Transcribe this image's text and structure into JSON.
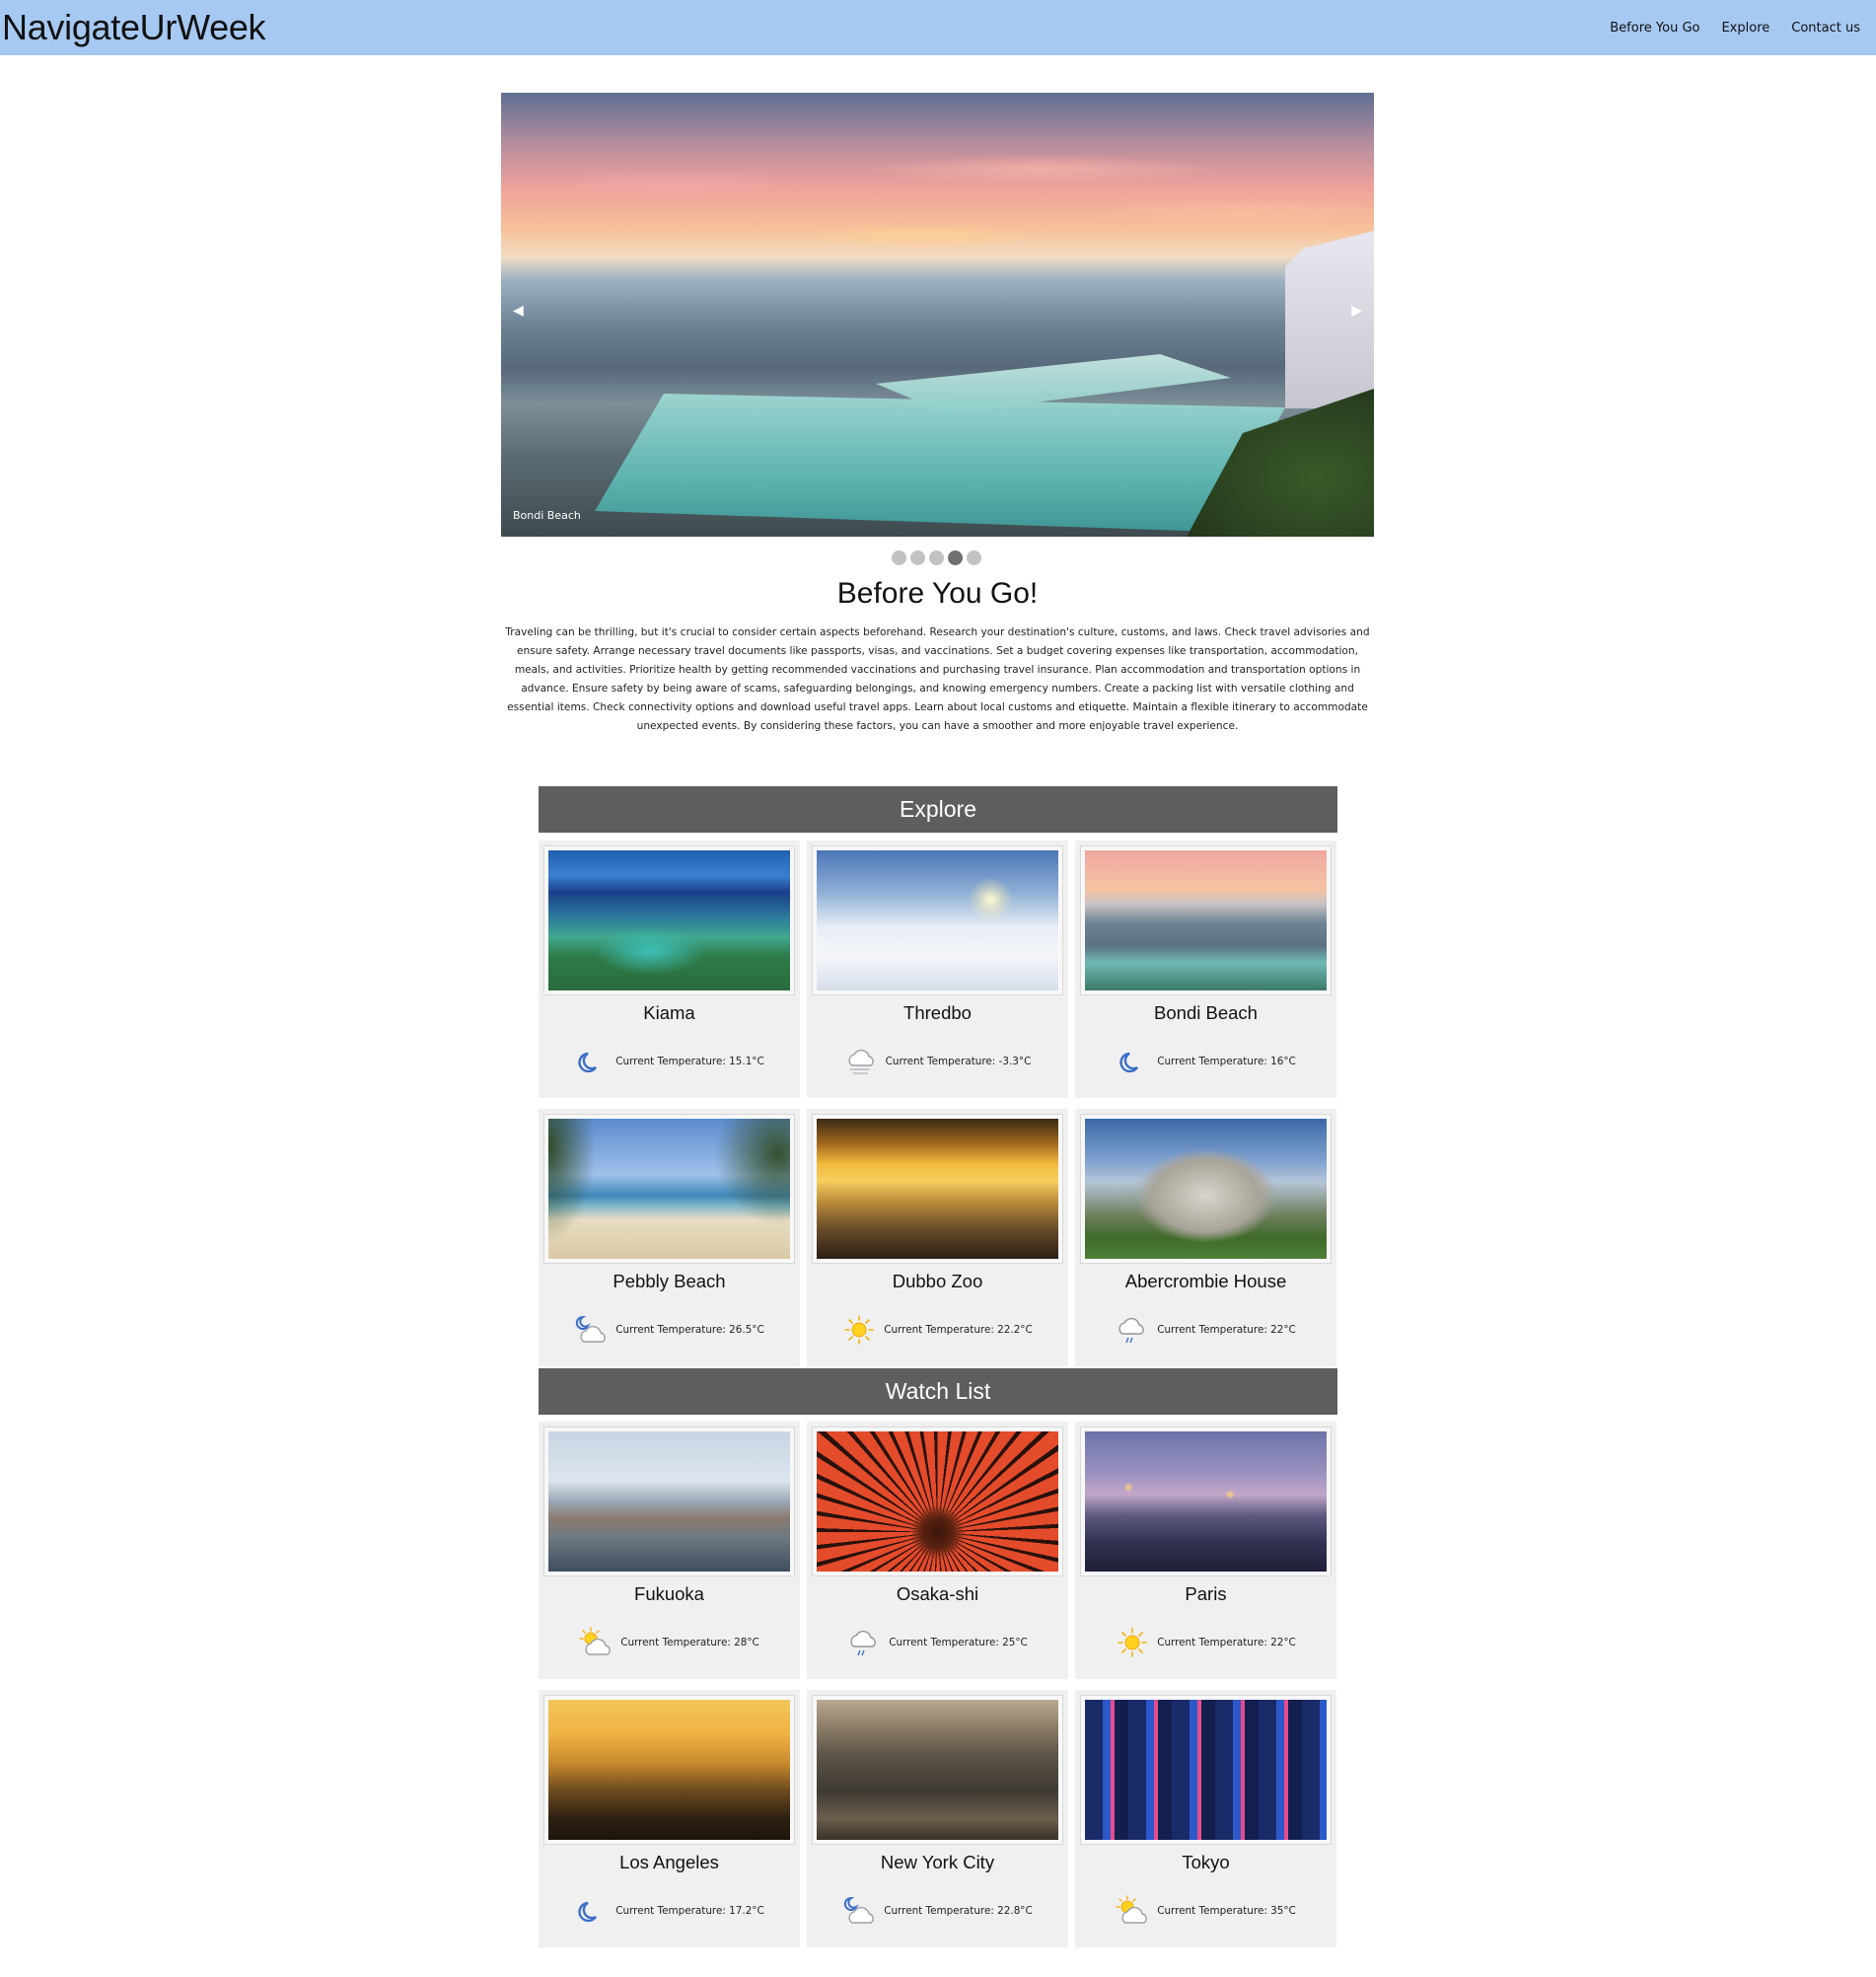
{
  "navbar": {
    "brand": "NavigateUrWeek",
    "links": [
      "Before You Go",
      "Explore",
      "Contact us"
    ],
    "background": "#a6c9f2"
  },
  "slideshow": {
    "caption": "Bondi Beach",
    "prev_icon": "triangle-left-icon",
    "next_icon": "triangle-right-icon",
    "prev_glyph": "◀",
    "next_glyph": "▶",
    "slide_count": 5,
    "active_slide": 4
  },
  "before_you_go": {
    "title": "Before You Go!",
    "text": "Traveling can be thrilling, but it's crucial to consider certain aspects beforehand. Research your destination's culture, customs, and laws. Check travel advisories and ensure safety. Arrange necessary travel documents like passports, visas, and vaccinations. Set a budget covering expenses like transportation, accommodation, meals, and activities. Prioritize health by getting recommended vaccinations and purchasing travel insurance. Plan accommodation and transportation options in advance. Ensure safety by being aware of scams, safeguarding belongings, and knowing emergency numbers. Create a packing list with versatile clothing and essential items. Check connectivity options and download useful travel apps. Learn about local customs and etiquette. Maintain a flexible itinerary to accommodate unexpected events. By considering these factors, you can have a smoother and more enjoyable travel experience."
  },
  "explore": {
    "title": "Explore",
    "cards": [
      {
        "name": "Kiama",
        "temperature": "Current Temperature: 15.1°C",
        "weather_icon": "moon-icon"
      },
      {
        "name": "Thredbo",
        "temperature": "Current Temperature: -3.3°C",
        "weather_icon": "fog-cloud-icon"
      },
      {
        "name": "Bondi Beach",
        "temperature": "Current Temperature: 16°C",
        "weather_icon": "moon-icon"
      },
      {
        "name": "Pebbly Beach",
        "temperature": "Current Temperature: 26.5°C",
        "weather_icon": "moon-cloud-icon"
      },
      {
        "name": "Dubbo Zoo",
        "temperature": "Current Temperature: 22.2°C",
        "weather_icon": "sun-icon"
      },
      {
        "name": "Abercrombie House",
        "temperature": "Current Temperature: 22°C",
        "weather_icon": "rain-cloud-icon"
      }
    ]
  },
  "watch_list": {
    "title": "Watch List",
    "cards": [
      {
        "name": "Fukuoka",
        "temperature": "Current Temperature: 28°C",
        "weather_icon": "sun-cloud-icon"
      },
      {
        "name": "Osaka-shi",
        "temperature": "Current Temperature: 25°C",
        "weather_icon": "rain-cloud-icon"
      },
      {
        "name": "Paris",
        "temperature": "Current Temperature: 22°C",
        "weather_icon": "sun-icon"
      },
      {
        "name": "Los Angeles",
        "temperature": "Current Temperature: 17.2°C",
        "weather_icon": "moon-icon"
      },
      {
        "name": "New York City",
        "temperature": "Current Temperature: 22.8°C",
        "weather_icon": "moon-cloud-icon"
      },
      {
        "name": "Tokyo",
        "temperature": "Current Temperature: 35°C",
        "weather_icon": "sun-cloud-icon"
      }
    ]
  }
}
